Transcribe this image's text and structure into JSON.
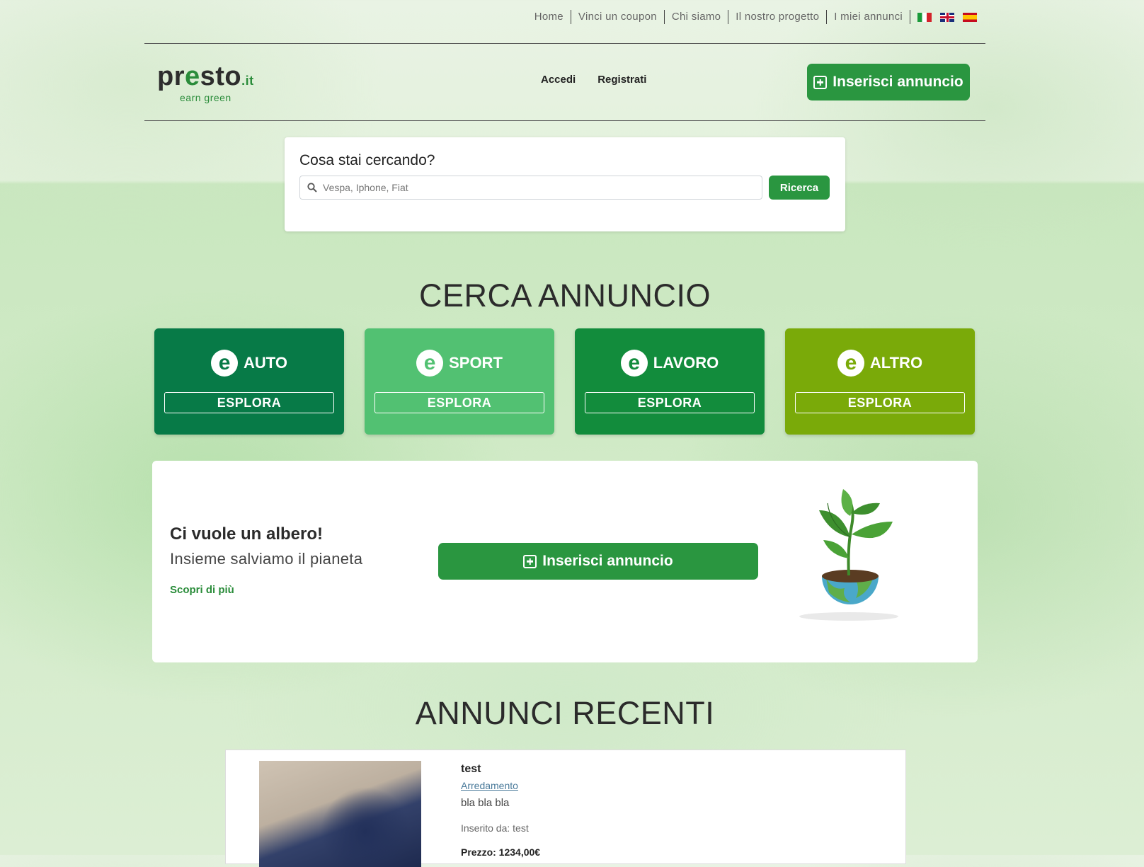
{
  "topnav": {
    "links": [
      "Home",
      "Vinci un coupon",
      "Chi siamo",
      "Il nostro progetto",
      "I miei annunci"
    ]
  },
  "logo": {
    "brand_left": "pr",
    "brand_e": "e",
    "brand_right": "sto",
    "tld": ".it",
    "tagline": "earn green"
  },
  "auth": {
    "login": "Accedi",
    "register": "Registrati"
  },
  "header": {
    "cta_label": "Inserisci annuncio"
  },
  "search": {
    "title": "Cosa stai cercando?",
    "placeholder": "Vespa, Iphone, Fiat",
    "button": "Ricerca"
  },
  "categories_section": {
    "title": "CERCA ANNUNCIO"
  },
  "categories": [
    {
      "name": "AUTO",
      "button": "ESPLORA",
      "color": "#077a47"
    },
    {
      "name": "SPORT",
      "button": "ESPLORA",
      "color": "#52c172"
    },
    {
      "name": "LAVORO",
      "button": "ESPLORA",
      "color": "#128c3c"
    },
    {
      "name": "ALTRO",
      "button": "ESPLORA",
      "color": "#7aaa09"
    }
  ],
  "tree": {
    "title": "Ci vuole un albero!",
    "subtitle": "Insieme salviamo il pianeta",
    "link": "Scopri di più",
    "cta_label": "Inserisci annuncio"
  },
  "recent_section": {
    "title": "ANNUNCI RECENTI"
  },
  "ad": {
    "title": "test",
    "category": "Arredamento",
    "description": "bla bla bla",
    "author": "Inserito da: test",
    "price": "Prezzo: 1234,00€"
  },
  "colors": {
    "primary": "#2a9640",
    "accent_text": "#2a8c3a"
  }
}
